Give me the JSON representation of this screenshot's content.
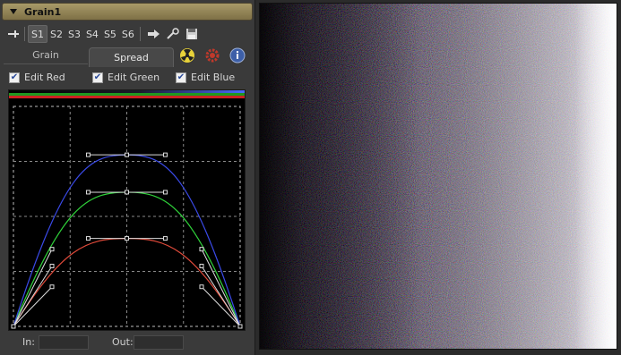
{
  "panel": {
    "title": "Grain1",
    "toolbar": {
      "slots": [
        "S1",
        "S2",
        "S3",
        "S4",
        "S5",
        "S6"
      ],
      "active_slot": "S1"
    },
    "tabs": [
      {
        "label": "Grain",
        "active": false
      },
      {
        "label": "Spread",
        "active": true
      }
    ],
    "checkboxes": [
      {
        "label": "Edit Red",
        "checked": true
      },
      {
        "label": "Edit Green",
        "checked": true
      },
      {
        "label": "Edit Blue",
        "checked": true
      }
    ],
    "io": {
      "in_label": "In:",
      "out_label": "Out:",
      "in_value": "",
      "out_value": ""
    }
  },
  "curves": {
    "colors": {
      "red": "#e04a3a",
      "green": "#2fd23a",
      "blue": "#3a4ae8"
    },
    "peaks": {
      "blue": 0.78,
      "green": 0.61,
      "red": 0.4
    }
  },
  "viewer": {
    "gradient": "black-to-white",
    "noise": "colored grain"
  }
}
